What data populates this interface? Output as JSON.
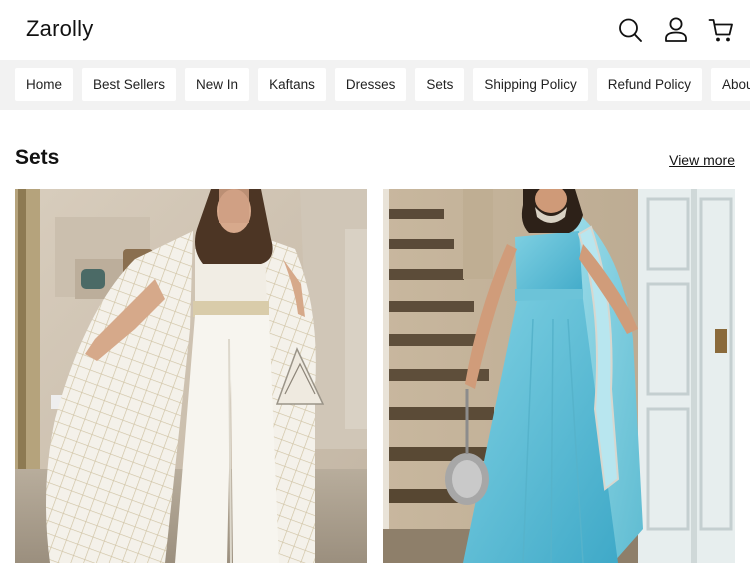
{
  "header": {
    "logo": "Zarolly",
    "icons": [
      "search-icon",
      "account-icon",
      "cart-icon"
    ]
  },
  "nav": {
    "items": [
      "Home",
      "Best Sellers",
      "New In",
      "Kaftans",
      "Dresses",
      "Sets",
      "Shipping Policy",
      "Refund Policy",
      "About"
    ]
  },
  "section": {
    "title": "Sets",
    "view_more": "View more"
  },
  "products": [
    {
      "image": "woman in white strapless jumpsuit with sheer checked cape and pearl triangle bag"
    },
    {
      "image": "woman in light blue strapless two-piece set with embellished blue dupatta"
    }
  ]
}
